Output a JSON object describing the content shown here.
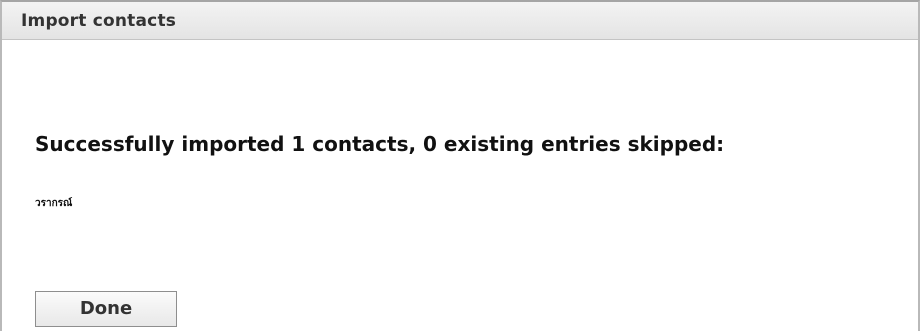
{
  "dialog": {
    "title": "Import contacts"
  },
  "result": {
    "message": "Successfully imported 1 contacts, 0 existing entries skipped:",
    "contacts": [
      "วรากรณ์"
    ]
  },
  "actions": {
    "done_label": "Done"
  }
}
